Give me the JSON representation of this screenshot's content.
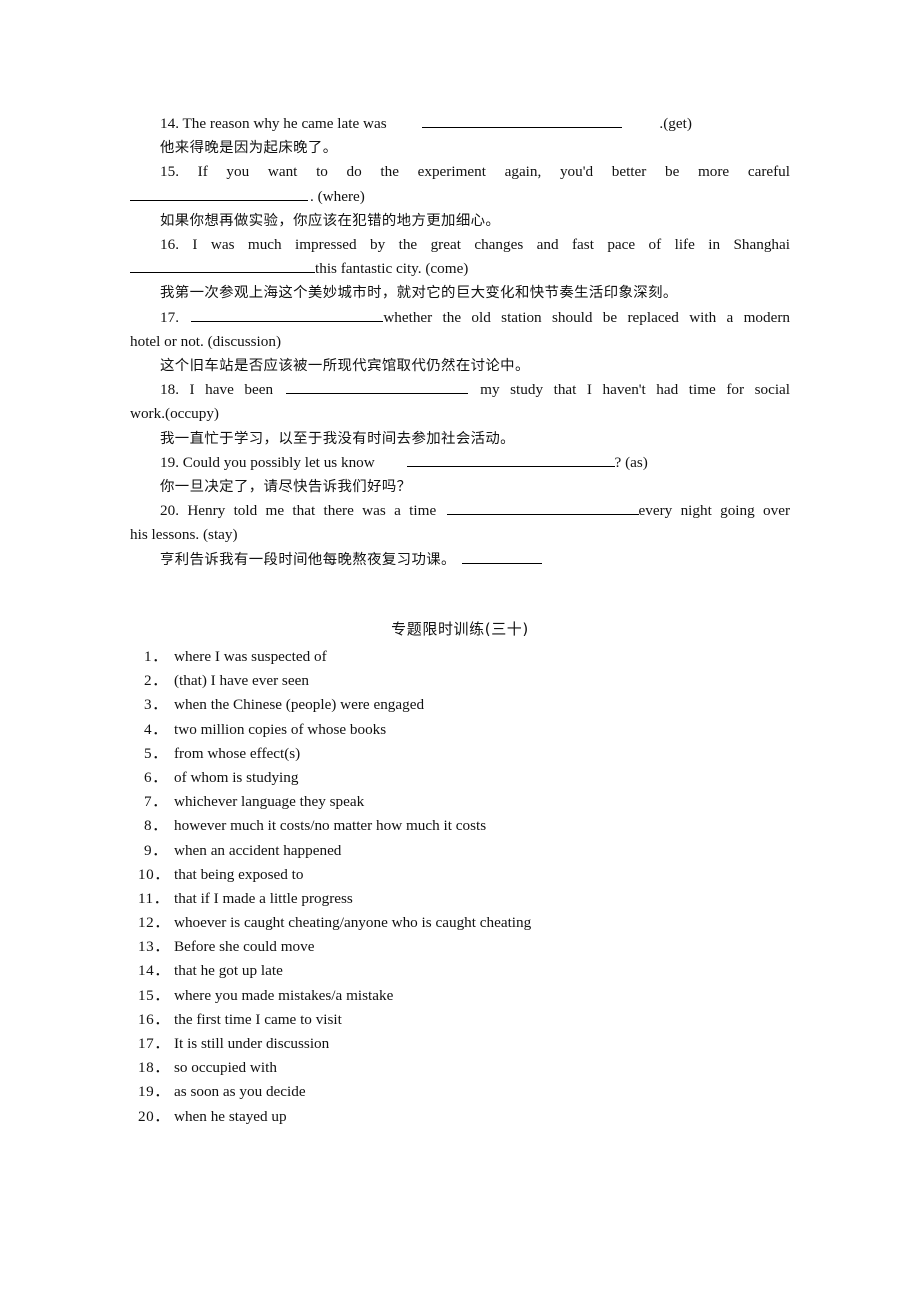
{
  "document": {
    "exercises": [
      {
        "id": "q14",
        "number": "14.",
        "english_pre": "The reason why he came late was",
        "blank_width": 200,
        "english_post": ".(get)",
        "chinese": "他来得晚是因为起床晚了。"
      },
      {
        "id": "q15",
        "number": "15.",
        "english_line1": "If you want to do the experiment again, you'd better be more careful",
        "blank_width": 178,
        "english_post": ".  (where)",
        "chinese": "如果你想再做实验，你应该在犯错的地方更加细心。"
      },
      {
        "id": "q16",
        "number": "16.",
        "english_line1": "I was much impressed by the great changes and fast pace of life in Shanghai",
        "blank_width": 185,
        "english_post": "this fantastic city. (come)",
        "chinese": "我第一次参观上海这个美妙城市时，就对它的巨大变化和快节奏生活印象深刻。"
      },
      {
        "id": "q17",
        "number": "17.",
        "blank_width": 192,
        "english_line1": "whether the old station should be replaced with a modern",
        "english_line2": "hotel or not. (discussion)",
        "chinese": "这个旧车站是否应该被一所现代宾馆取代仍然在讨论中。"
      },
      {
        "id": "q18",
        "number": "18.",
        "english_pre": "I have been",
        "blank_width": 182,
        "english_line1": "my study that I haven't had time for social",
        "english_line2": "work.(occupy)",
        "chinese": "我一直忙于学习，以至于我没有时间去参加社会活动。"
      },
      {
        "id": "q19",
        "number": "19.",
        "english_pre": "Could you possibly let us know",
        "blank_width": 208,
        "english_post": "? (as)",
        "chinese": "你一旦决定了，请尽快告诉我们好吗？"
      },
      {
        "id": "q20",
        "number": "20.",
        "english_pre": "Henry told me that there was a time",
        "blank_width": 192,
        "english_line1": "every night going over",
        "english_line2": "his lessons. (stay)",
        "chinese": "亨利告诉我有一段时间他每晚熬夜复习功课。",
        "trailing_blank_width": 80
      }
    ],
    "answers_section": {
      "heading": "专题限时训练(三十)",
      "items": [
        {
          "number": "1．",
          "text": "where I was suspected of"
        },
        {
          "number": "2．",
          "text": "(that) I have ever seen"
        },
        {
          "number": "3．",
          "text": "when the Chinese (people) were engaged"
        },
        {
          "number": "4．",
          "text": "two million copies of whose books"
        },
        {
          "number": "5．",
          "text": "from whose effect(s)"
        },
        {
          "number": "6．",
          "text": "of whom is studying"
        },
        {
          "number": "7．",
          "text": "whichever language they speak"
        },
        {
          "number": "8．",
          "text": "however much it costs/no matter how much it costs"
        },
        {
          "number": "9．",
          "text": "when an accident happened"
        },
        {
          "number": "10．",
          "text": "that being exposed to"
        },
        {
          "number": "11．",
          "text": "that if I made a little progress"
        },
        {
          "number": "12．",
          "text": "whoever is caught cheating/anyone who is caught cheating"
        },
        {
          "number": "13．",
          "text": "Before she could move"
        },
        {
          "number": "14．",
          "text": "that he got up late"
        },
        {
          "number": "15．",
          "text": "where you made mistakes/a mistake"
        },
        {
          "number": "16．",
          "text": "the first time I came to visit"
        },
        {
          "number": "17．",
          "text": "It is still under discussion"
        },
        {
          "number": "18．",
          "text": "so occupied with"
        },
        {
          "number": "19．",
          "text": "as soon as you decide"
        },
        {
          "number": "20．",
          "text": "when he stayed up"
        }
      ]
    }
  }
}
